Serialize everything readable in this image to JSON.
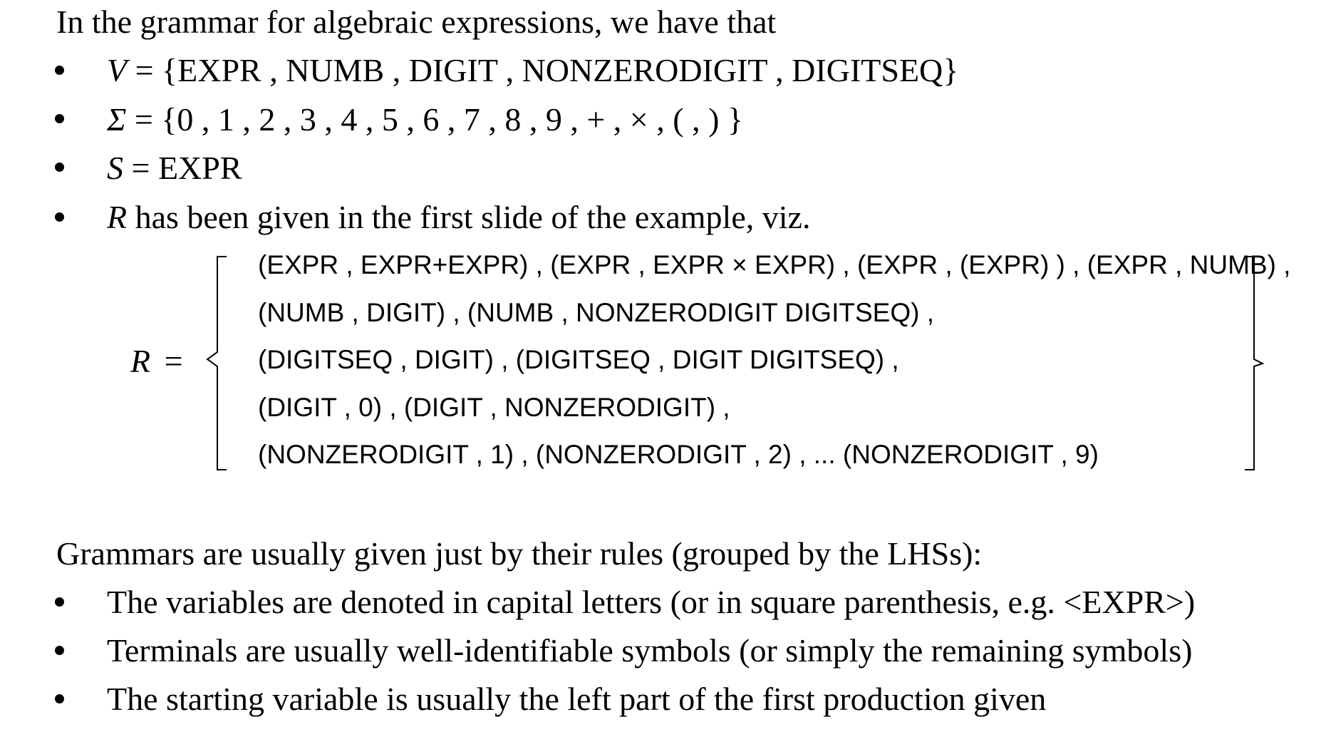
{
  "intro": "In the grammar for algebraic expressions, we have that",
  "definitions": [
    {
      "symbol": "V",
      "rest": " = {EXPR , NUMB , DIGIT , NONZERODIGIT , DIGITSEQ}"
    },
    {
      "symbol": "Σ",
      "rest": " = {0 , 1 , 2 , 3 , 4 , 5 , 6 , 7 , 8 , 9 , + ,  × , ( , ) }"
    },
    {
      "symbol": "S",
      "rest": " = EXPR"
    },
    {
      "symbol": "R",
      "rest": " has been given in the first slide of the example, viz."
    }
  ],
  "rules": {
    "label_symbol": "R",
    "label_eq": "=",
    "lines": [
      "(EXPR , EXPR+EXPR) , (EXPR , EXPR × EXPR) , (EXPR , (EXPR) ) , (EXPR , NUMB) ,",
      "(NUMB , DIGIT) , (NUMB , NONZERODIGIT DIGITSEQ) ,",
      "(DIGITSEQ , DIGIT) , (DIGITSEQ , DIGIT DIGITSEQ) ,",
      "(DIGIT , 0) , (DIGIT , NONZERODIGIT) ,",
      "(NONZERODIGIT , 1) , (NONZERODIGIT , 2) , ... (NONZERODIGIT , 9)"
    ]
  },
  "summary": {
    "heading": "Grammars are usually given just by their rules (grouped by the LHSs):",
    "items": [
      "The variables are denoted in capital letters (or in square parenthesis, e.g. <EXPR>)",
      "Terminals are usually well-identifiable symbols (or simply the remaining symbols)",
      "The starting variable is usually the left part of the first production given"
    ]
  }
}
